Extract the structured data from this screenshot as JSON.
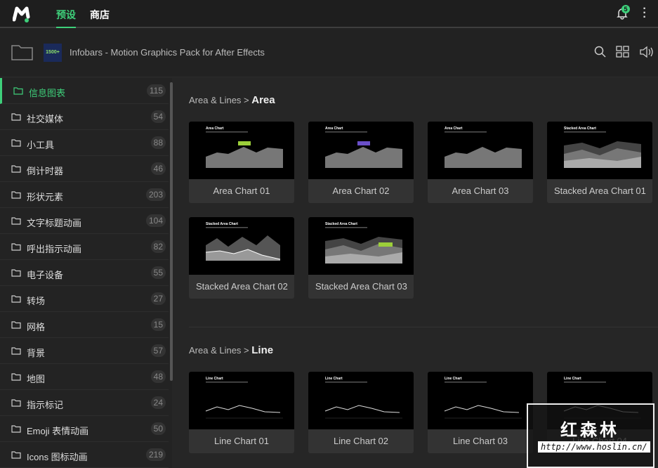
{
  "topbar": {
    "tabs": [
      "预设",
      "商店"
    ],
    "notification_count": "5"
  },
  "header": {
    "pack_badge": "1500+",
    "pack_title": "Infobars - Motion Graphics Pack for After Effects"
  },
  "sidebar": {
    "items": [
      {
        "label": "信息图表",
        "count": "115"
      },
      {
        "label": "社交媒体",
        "count": "54"
      },
      {
        "label": "小工具",
        "count": "88"
      },
      {
        "label": "倒计时器",
        "count": "46"
      },
      {
        "label": "形状元素",
        "count": "203"
      },
      {
        "label": "文字标题动画",
        "count": "104"
      },
      {
        "label": "呼出指示动画",
        "count": "82"
      },
      {
        "label": "电子设备",
        "count": "55"
      },
      {
        "label": "转场",
        "count": "27"
      },
      {
        "label": "网格",
        "count": "15"
      },
      {
        "label": "背景",
        "count": "57"
      },
      {
        "label": "地图",
        "count": "48"
      },
      {
        "label": "指示标记",
        "count": "24"
      },
      {
        "label": "Emoji 表情动画",
        "count": "50"
      },
      {
        "label": "Icons 图标动画",
        "count": "219"
      }
    ]
  },
  "sections": [
    {
      "prefix": "Area & Lines > ",
      "name": "Area",
      "cards": [
        {
          "label": "Area Chart 01",
          "thumb_title": "Area Chart",
          "kind": "area",
          "accent": "#9ccf3a"
        },
        {
          "label": "Area Chart 02",
          "thumb_title": "Area Chart",
          "kind": "area",
          "accent": "#6a4fc9"
        },
        {
          "label": "Area Chart 03",
          "thumb_title": "Area Chart",
          "kind": "area",
          "accent": ""
        },
        {
          "label": "Stacked Area Chart 01",
          "thumb_title": "Stacked Area Chart",
          "kind": "stacked",
          "accent": ""
        },
        {
          "label": "Stacked Area Chart 02",
          "thumb_title": "Stacked Area Chart",
          "kind": "stacked2",
          "accent": ""
        },
        {
          "label": "Stacked Area Chart 03",
          "thumb_title": "Stacked Area Chart",
          "kind": "stacked",
          "accent": "#9ccf3a"
        }
      ]
    },
    {
      "prefix": "Area & Lines > ",
      "name": "Line",
      "cards": [
        {
          "label": "Line Chart 01",
          "thumb_title": "Line Chart",
          "kind": "line",
          "accent": ""
        },
        {
          "label": "Line Chart 02",
          "thumb_title": "Line Chart",
          "kind": "line",
          "accent": ""
        },
        {
          "label": "Line Chart 03",
          "thumb_title": "Line Chart",
          "kind": "line",
          "accent": ""
        },
        {
          "label": "Line Chart 04",
          "thumb_title": "Line Chart",
          "kind": "line",
          "accent": ""
        }
      ]
    }
  ],
  "watermark": {
    "name": "红森林",
    "url": "http://www.hoslin.cn/"
  }
}
